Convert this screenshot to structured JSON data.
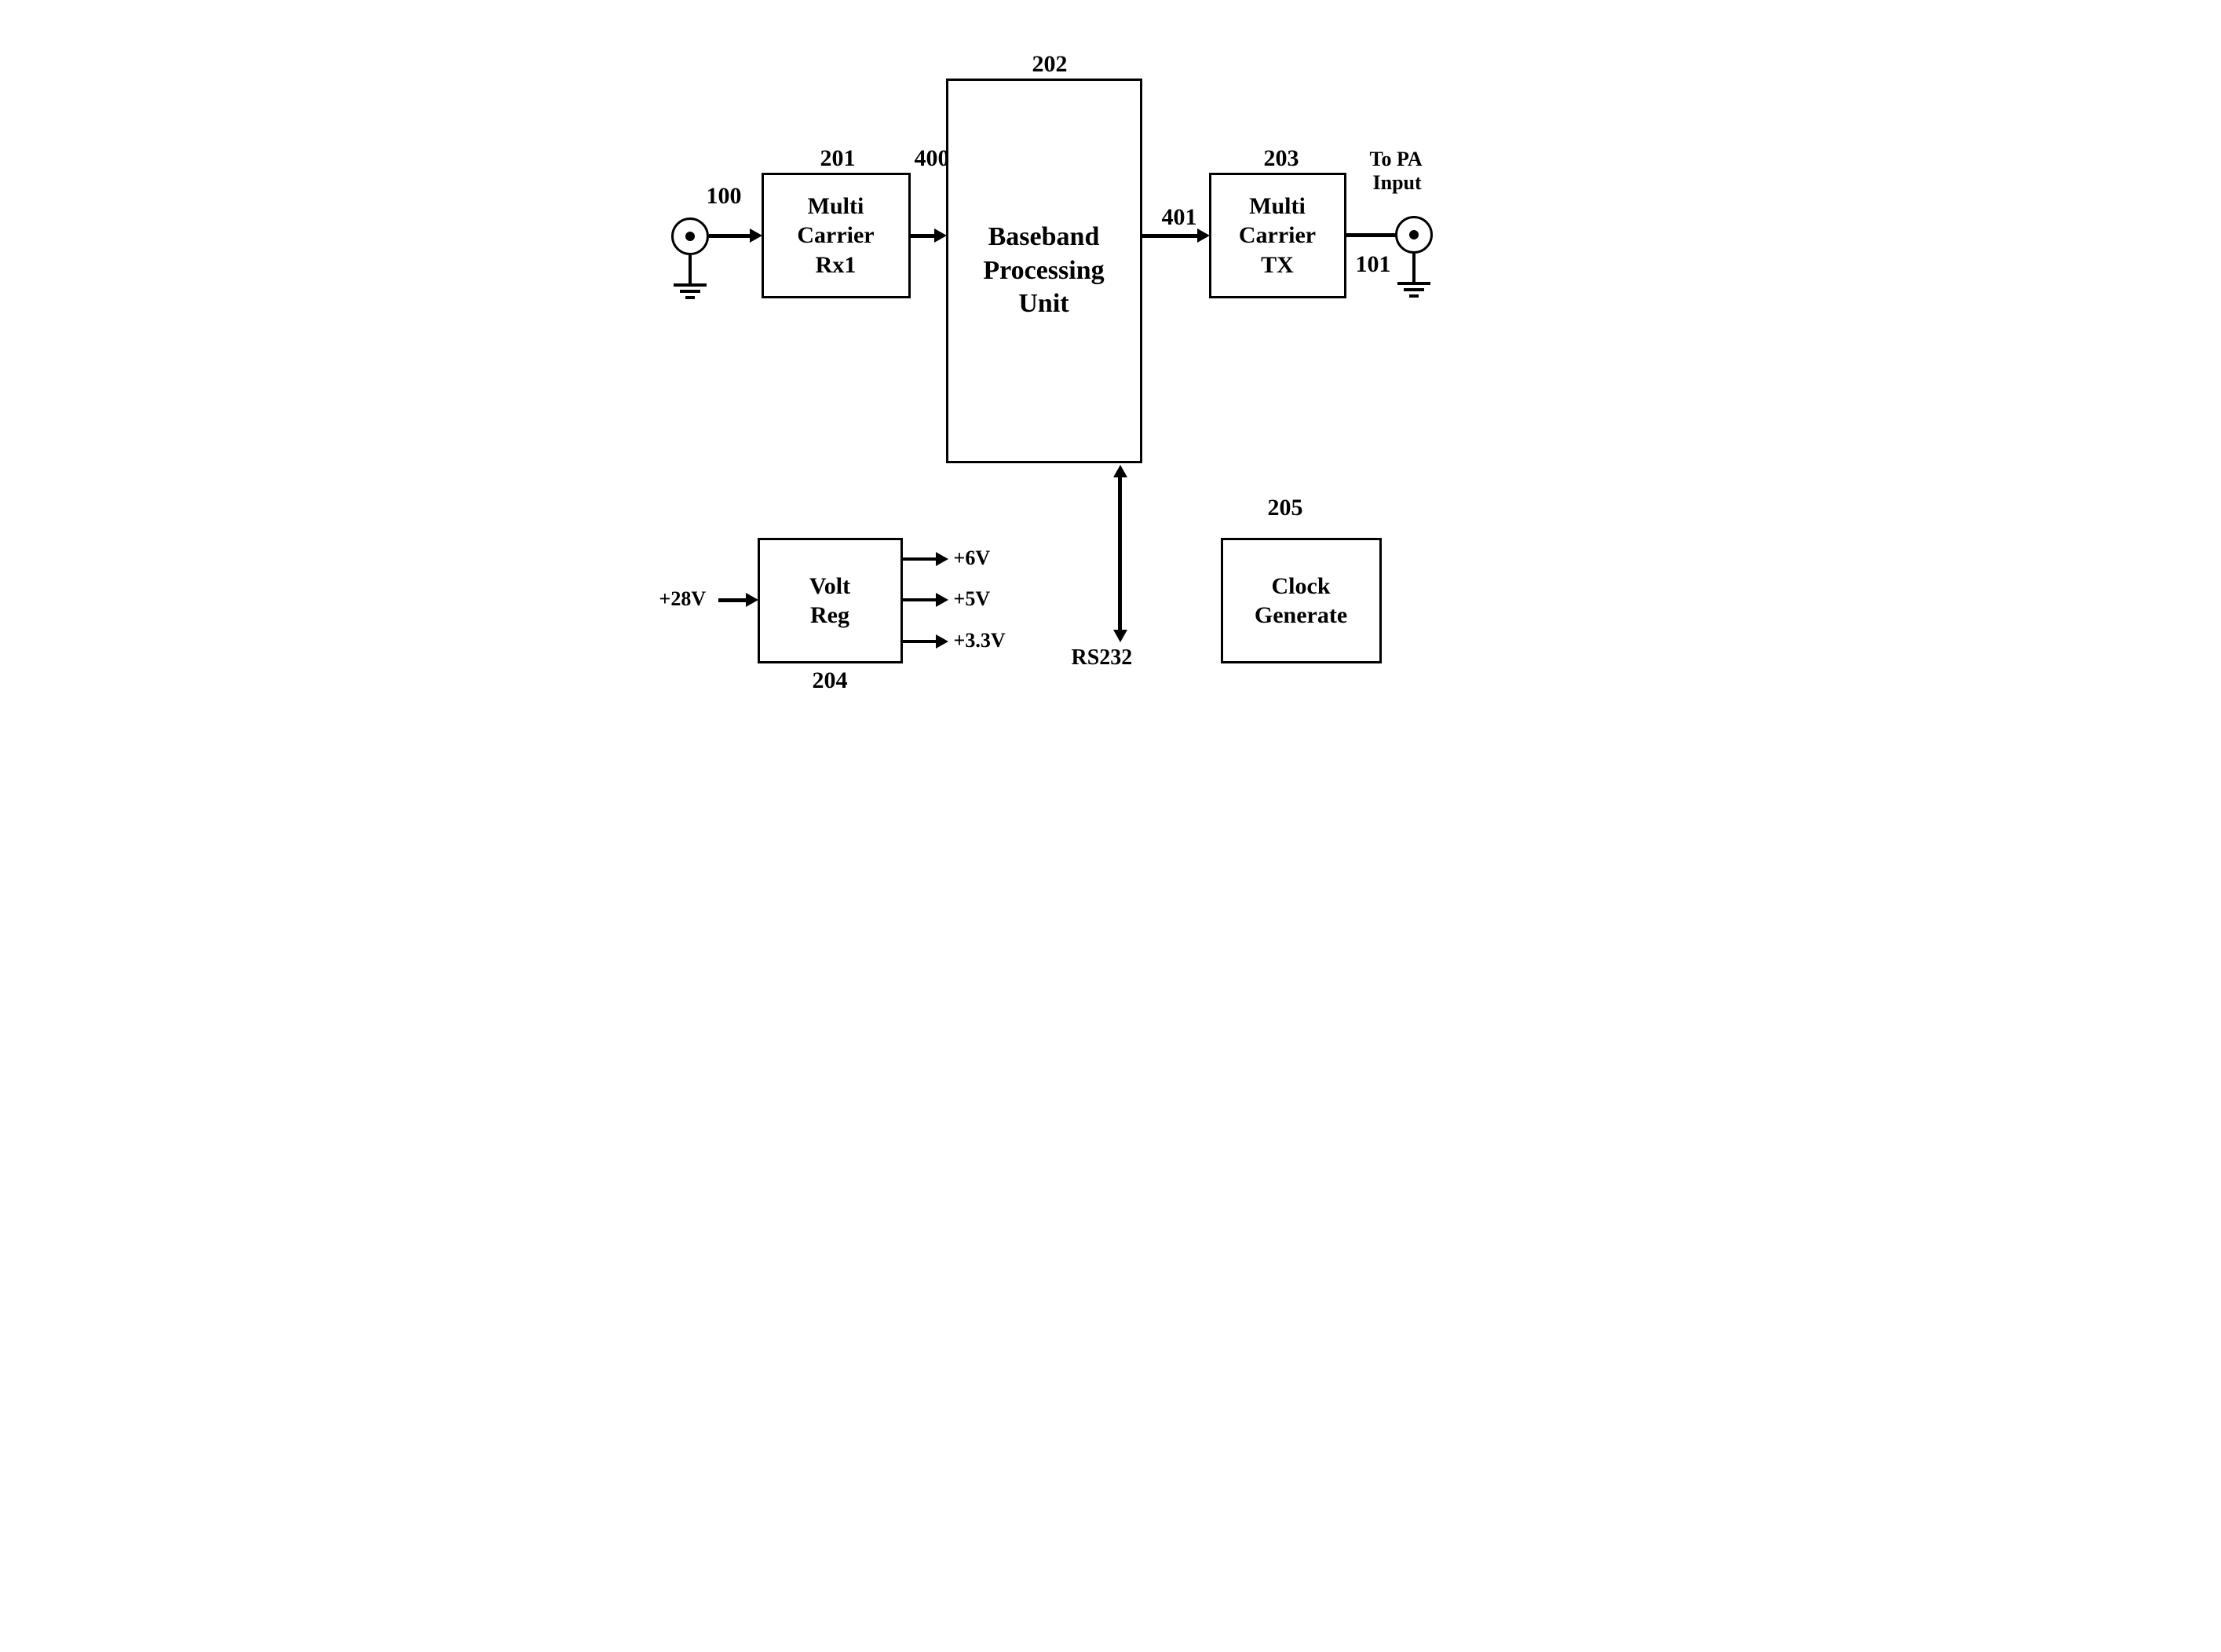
{
  "refs": {
    "rx_conn": "100",
    "tx_conn": "101",
    "rx_box": "201",
    "bpu_box": "202",
    "tx_box": "203",
    "volt_box": "204",
    "clock_box": "205",
    "bpu_in": "400",
    "bpu_out": "401"
  },
  "blocks": {
    "rx": "Multi\nCarrier\nRx1",
    "bpu": "Baseband\nProcessing\nUnit",
    "tx": "Multi\nCarrier\nTX",
    "volt": "Volt\nReg",
    "clock": "Clock\nGenerate"
  },
  "signals": {
    "volt_in": "+28V",
    "volt_out1": "+6V",
    "volt_out2": "+5V",
    "volt_out3": "+3.3V",
    "bpu_serial": "RS232",
    "tx_out_note_l1": "To PA",
    "tx_out_note_l2": "Input"
  }
}
